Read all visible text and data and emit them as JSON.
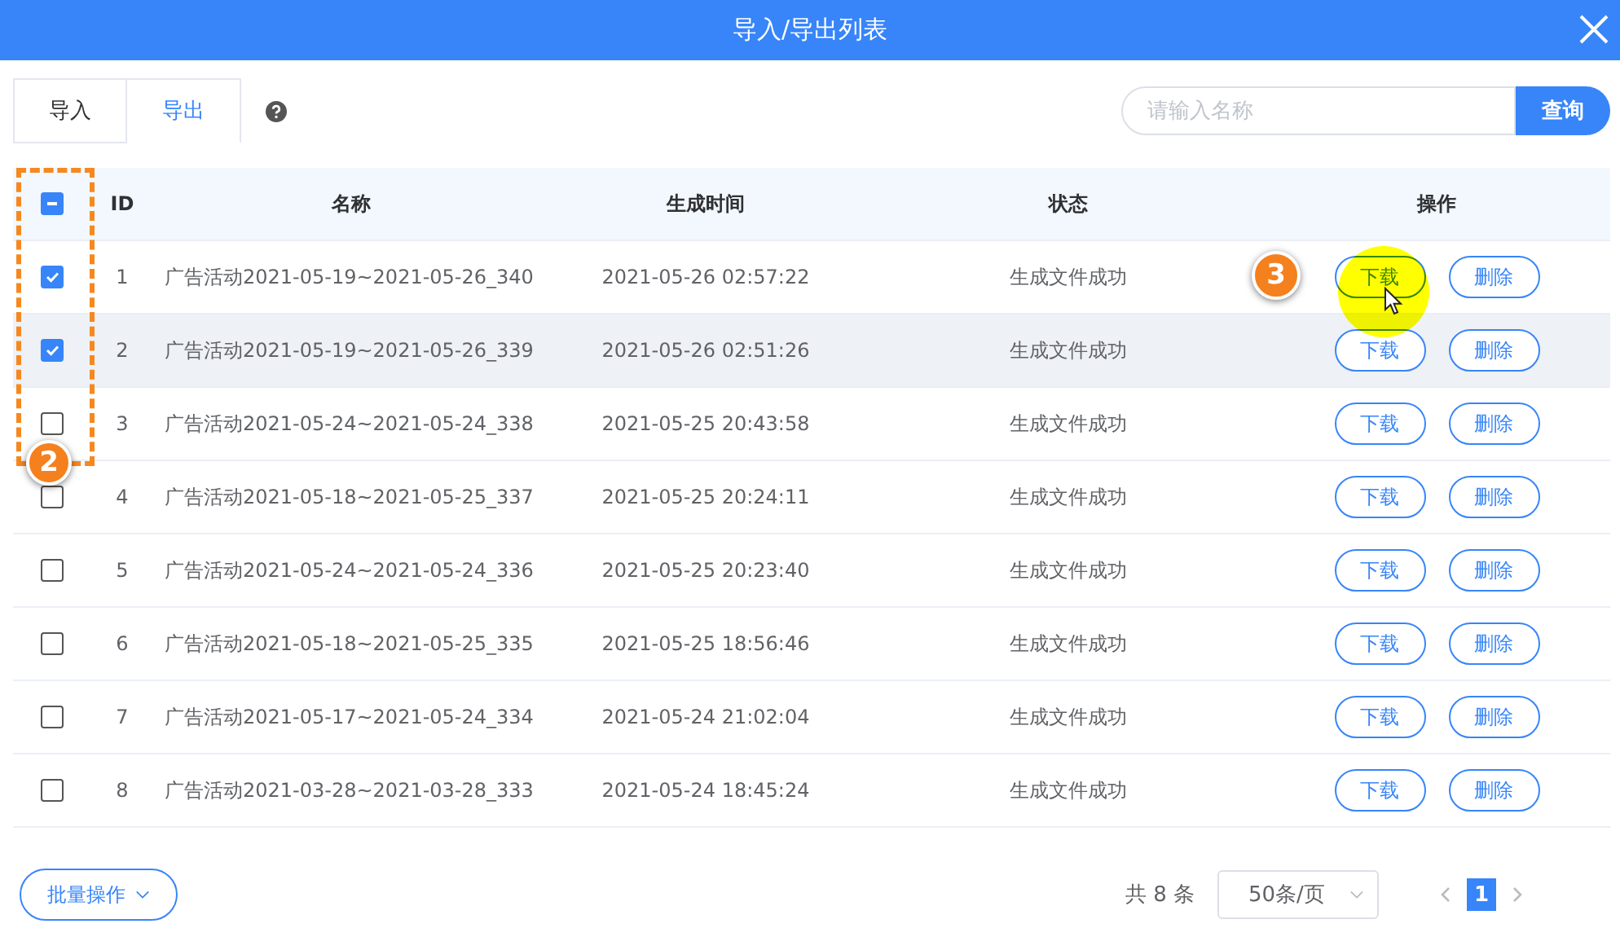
{
  "window": {
    "title": "导入/导出列表"
  },
  "tabs": [
    {
      "label": "导入",
      "selected": false
    },
    {
      "label": "导出",
      "selected": true
    }
  ],
  "search": {
    "placeholder": "请输入名称",
    "button": "查询"
  },
  "table": {
    "columns": [
      "ID",
      "名称",
      "生成时间",
      "状态",
      "操作"
    ],
    "select_all": {
      "indeterminate": true
    },
    "rows": [
      {
        "checked": true,
        "highlighted": false,
        "id": "1",
        "name": "广告活动2021-05-19~2021-05-26_340",
        "time": "2021-05-26 02:57:22",
        "status": "生成文件成功",
        "actions": [
          "下载",
          "删除"
        ]
      },
      {
        "checked": true,
        "highlighted": true,
        "id": "2",
        "name": "广告活动2021-05-19~2021-05-26_339",
        "time": "2021-05-26 02:51:26",
        "status": "生成文件成功",
        "actions": [
          "下载",
          "删除"
        ]
      },
      {
        "checked": false,
        "highlighted": false,
        "id": "3",
        "name": "广告活动2021-05-24~2021-05-24_338",
        "time": "2021-05-25 20:43:58",
        "status": "生成文件成功",
        "actions": [
          "下载",
          "删除"
        ]
      },
      {
        "checked": false,
        "highlighted": false,
        "id": "4",
        "name": "广告活动2021-05-18~2021-05-25_337",
        "time": "2021-05-25 20:24:11",
        "status": "生成文件成功",
        "actions": [
          "下载",
          "删除"
        ]
      },
      {
        "checked": false,
        "highlighted": false,
        "id": "5",
        "name": "广告活动2021-05-24~2021-05-24_336",
        "time": "2021-05-25 20:23:40",
        "status": "生成文件成功",
        "actions": [
          "下载",
          "删除"
        ]
      },
      {
        "checked": false,
        "highlighted": false,
        "id": "6",
        "name": "广告活动2021-05-18~2021-05-25_335",
        "time": "2021-05-25 18:56:46",
        "status": "生成文件成功",
        "actions": [
          "下载",
          "删除"
        ]
      },
      {
        "checked": false,
        "highlighted": false,
        "id": "7",
        "name": "广告活动2021-05-17~2021-05-24_334",
        "time": "2021-05-24 21:02:04",
        "status": "生成文件成功",
        "actions": [
          "下载",
          "删除"
        ]
      },
      {
        "checked": false,
        "highlighted": false,
        "id": "8",
        "name": "广告活动2021-03-28~2021-03-28_333",
        "time": "2021-05-24 18:45:24",
        "status": "生成文件成功",
        "actions": [
          "下载",
          "删除"
        ]
      }
    ]
  },
  "footer": {
    "batch_button": "批量操作",
    "total": "共 8 条",
    "page_size": "50条/页",
    "pages": [
      {
        "label": "1",
        "selected": true
      }
    ]
  },
  "annotations": [
    {
      "kind": "frame-badge",
      "label": "2"
    },
    {
      "kind": "click-badge",
      "label": "3"
    }
  ]
}
